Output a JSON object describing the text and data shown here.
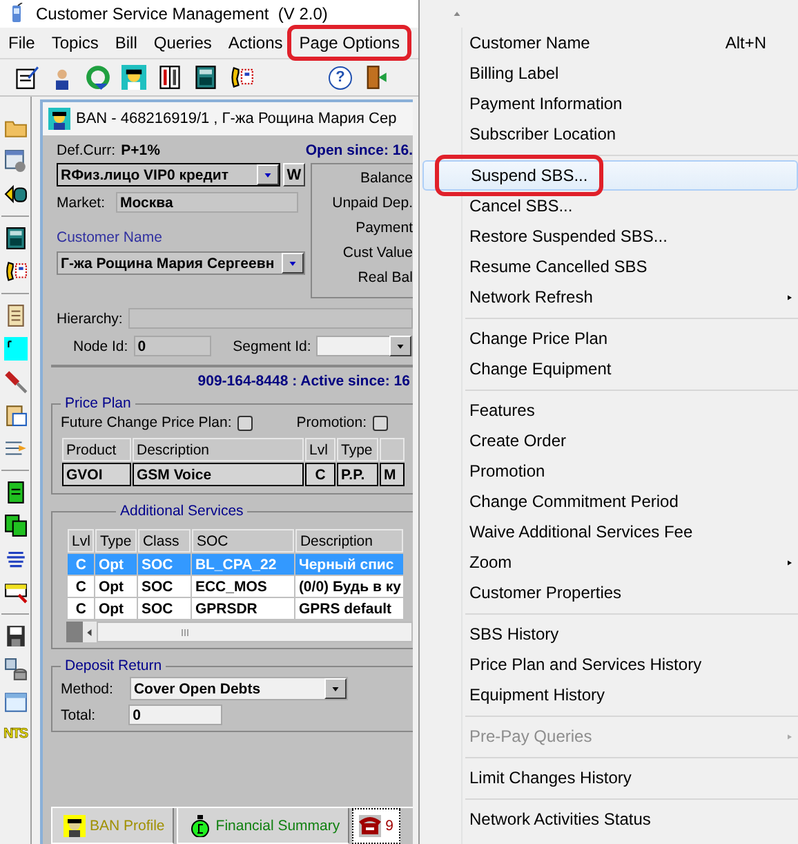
{
  "window": {
    "title": "Customer Service Management  (V 2.0)"
  },
  "menubar": [
    {
      "label": "File",
      "annotated": false
    },
    {
      "label": "Topics",
      "annotated": false
    },
    {
      "label": "Bill",
      "annotated": false
    },
    {
      "label": "Queries",
      "annotated": false
    },
    {
      "label": "Actions",
      "annotated": false
    },
    {
      "label": "Page Options",
      "annotated": true
    }
  ],
  "toolbar": {
    "help_glyph": "?"
  },
  "side_toolbar": {
    "text_icon": "NTS"
  },
  "ban_window": {
    "title": "BAN - 468216919/1 , Г-жа Рощина Мария Сер",
    "def_curr_label": "Def.Curr:",
    "def_curr": "P+1%",
    "open_since": "Open since: 16.",
    "account_type": "RФиз.лицо  VIP0  кредит",
    "w_button": "W",
    "market_label": "Market:",
    "market": "Москва",
    "customer_name_label": "Customer Name",
    "customer_name": "Г-жа Рощина Мария Сергеевн",
    "balance_labels": [
      "Balance",
      "Unpaid Dep.",
      "Payment",
      "Cust Value",
      "Real Bal"
    ],
    "hierarchy_label": "Hierarchy:",
    "node_id_label": "Node Id:",
    "node_id": "0",
    "segment_id_label": "Segment Id:"
  },
  "subscriber": {
    "heading": "909-164-8448 : Active since: 16",
    "price_plan": {
      "title": "Price Plan",
      "future_change_label": "Future Change Price Plan:",
      "future_change_checked": false,
      "promotion_label": "Promotion:",
      "promotion_checked": false,
      "columns": [
        "Product",
        "Description",
        "Lvl",
        "Type"
      ],
      "rows": [
        [
          "GVOI",
          "GSM Voice",
          "C",
          "P.P.",
          "M"
        ]
      ]
    },
    "additional_services": {
      "title": "Additional Services",
      "columns": [
        "Lvl",
        "Type",
        "Class",
        "SOC",
        "Description"
      ],
      "rows": [
        {
          "cells": [
            "C",
            "Opt",
            "SOC",
            "BL_CPA_22",
            "Черный спис"
          ],
          "selected": true
        },
        {
          "cells": [
            "C",
            "Opt",
            "SOC",
            "ECC_MOS",
            "(0/0) Будь в ку"
          ],
          "selected": false
        },
        {
          "cells": [
            "C",
            "Opt",
            "SOC",
            "GPRSDR",
            "GPRS default"
          ],
          "selected": false
        }
      ]
    },
    "deposit_return": {
      "title": "Deposit Return",
      "method_label": "Method:",
      "method": "Cover Open Debts",
      "total_label": "Total:",
      "total": "0"
    }
  },
  "bottom_tabs": [
    {
      "label": "BAN Profile",
      "kind": "profile",
      "selected": false
    },
    {
      "label": "Financial Summary",
      "kind": "money",
      "selected": false
    },
    {
      "label": "9",
      "kind": "phone",
      "selected": true
    }
  ],
  "menu": {
    "groups": [
      [
        {
          "label": "Customer Name",
          "shortcut": "Alt+N",
          "submenu": false,
          "disabled": false,
          "selected": false,
          "annotated": false
        },
        {
          "label": "Billing Label",
          "submenu": false,
          "disabled": false,
          "selected": false,
          "annotated": false
        },
        {
          "label": "Payment Information",
          "submenu": false,
          "disabled": false,
          "selected": false,
          "annotated": false
        },
        {
          "label": "Subscriber Location",
          "submenu": false,
          "disabled": false,
          "selected": false,
          "annotated": false
        }
      ],
      [
        {
          "label": "Suspend SBS...",
          "submenu": false,
          "disabled": false,
          "selected": true,
          "annotated": true
        },
        {
          "label": "Cancel SBS...",
          "submenu": false,
          "disabled": false,
          "selected": false,
          "annotated": false
        },
        {
          "label": "Restore Suspended SBS...",
          "submenu": false,
          "disabled": false,
          "selected": false,
          "annotated": false
        },
        {
          "label": "Resume Cancelled SBS",
          "submenu": false,
          "disabled": false,
          "selected": false,
          "annotated": false
        },
        {
          "label": "Network Refresh",
          "submenu": true,
          "disabled": false,
          "selected": false,
          "annotated": false
        }
      ],
      [
        {
          "label": "Change Price Plan",
          "submenu": false,
          "disabled": false,
          "selected": false,
          "annotated": false
        },
        {
          "label": "Change Equipment",
          "submenu": false,
          "disabled": false,
          "selected": false,
          "annotated": false
        }
      ],
      [
        {
          "label": "Features",
          "submenu": false,
          "disabled": false,
          "selected": false,
          "annotated": false
        },
        {
          "label": "Create Order",
          "submenu": false,
          "disabled": false,
          "selected": false,
          "annotated": false
        },
        {
          "label": "Promotion",
          "submenu": false,
          "disabled": false,
          "selected": false,
          "annotated": false
        },
        {
          "label": "Change Commitment Period",
          "submenu": false,
          "disabled": false,
          "selected": false,
          "annotated": false
        },
        {
          "label": "Waive Additional Services Fee",
          "submenu": false,
          "disabled": false,
          "selected": false,
          "annotated": false
        },
        {
          "label": "Zoom",
          "submenu": true,
          "disabled": false,
          "selected": false,
          "annotated": false
        },
        {
          "label": "Customer Properties",
          "submenu": false,
          "disabled": false,
          "selected": false,
          "annotated": false
        }
      ],
      [
        {
          "label": "SBS History",
          "submenu": false,
          "disabled": false,
          "selected": false,
          "annotated": false
        },
        {
          "label": "Price Plan and Services History",
          "submenu": false,
          "disabled": false,
          "selected": false,
          "annotated": false
        },
        {
          "label": "Equipment History",
          "submenu": false,
          "disabled": false,
          "selected": false,
          "annotated": false
        }
      ],
      [
        {
          "label": "Pre-Pay Queries",
          "submenu": true,
          "disabled": true,
          "selected": false,
          "annotated": false
        }
      ],
      [
        {
          "label": "Limit Changes History",
          "submenu": false,
          "disabled": false,
          "selected": false,
          "annotated": false
        }
      ],
      [
        {
          "label": "Network Activities Status",
          "submenu": false,
          "disabled": false,
          "selected": false,
          "annotated": false
        }
      ]
    ]
  }
}
